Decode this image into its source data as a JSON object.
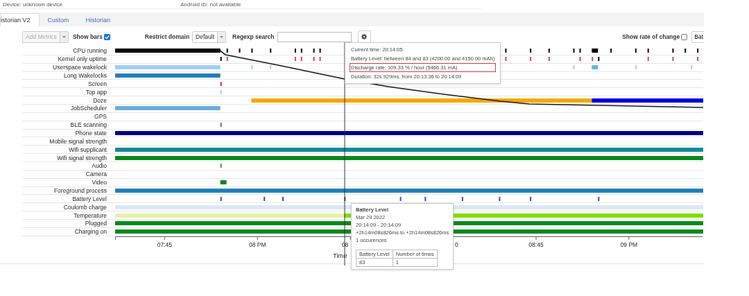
{
  "header": {
    "device": "Device: unknown device",
    "android_id": "Android ID: not available"
  },
  "tabs": [
    {
      "label": "istorian V2",
      "selected": true
    },
    {
      "label": "Custom",
      "selected": false
    },
    {
      "label": "Historian",
      "selected": false
    }
  ],
  "toolbar": {
    "add_metrics": {
      "label": "Add Metrics",
      "disabled": true
    },
    "show_bars": {
      "label": "Show bars",
      "checked": true
    },
    "restrict_domain": {
      "label": "Restrict domain",
      "value": "Default"
    },
    "regexp_search": {
      "label": "Regexp search"
    },
    "show_rate": {
      "label": "Show rate of change",
      "checked": false
    },
    "cut_button": "Bat"
  },
  "timeline": {
    "rows": [
      {
        "label": "CPU running",
        "color": "#000000"
      },
      {
        "label": "Kernel only uptime",
        "color": "#e8384f"
      },
      {
        "label": "Userspace wakelock",
        "color": "#9fd0f0"
      },
      {
        "label": "Long Wakelocks",
        "color": "#1f7fb8"
      },
      {
        "label": "Screen",
        "color": "#e82020"
      },
      {
        "label": "Top app",
        "color": "#9fd0f0"
      },
      {
        "label": "Doze",
        "color": "#f5a800"
      },
      {
        "label": "JobScheduler",
        "color": "#6aaedb"
      },
      {
        "label": "GPS"
      },
      {
        "label": "BLE scanning",
        "color": "#1a9a3a"
      },
      {
        "label": "Phone state",
        "color": "#000080"
      },
      {
        "label": "Mobile signal strength"
      },
      {
        "label": "Wifi supplicant",
        "color": "#128a9a"
      },
      {
        "label": "Wifi signal strength",
        "color": "#0a8a1a"
      },
      {
        "label": "Audio",
        "color": "#2aa02a"
      },
      {
        "label": "Camera"
      },
      {
        "label": "Video",
        "color": "#0a8a1a"
      },
      {
        "label": "Foreground process",
        "color": "#1f7fb8"
      },
      {
        "label": "Battery Level",
        "color": "#3a3ae0"
      },
      {
        "label": "Coulomb charge",
        "color": "#dce8f4"
      },
      {
        "label": "Temperature",
        "color": "#e8f0a8"
      },
      {
        "label": "Plugged",
        "color": "#0a8a1a"
      },
      {
        "label": "Charging on",
        "color": "#0a8a1a"
      }
    ],
    "x_ticks": [
      "07:45",
      "08 PM",
      "08",
      "0",
      "08:45",
      "09 PM"
    ],
    "x_label": "Time"
  },
  "info_tooltip": {
    "lines": [
      {
        "text": "Current time: 20:14:05",
        "highlighted": false
      },
      {
        "text": "Battery Level: between 84 and 83 (4200.00 and 4150.00 mAh)",
        "highlighted": false
      },
      {
        "text": "Discharge rate: 109.33 % / hour (5466.31 mA)",
        "highlighted": true
      },
      {
        "text": "Duration: 32s 929ms, from 20:13:36 to 20:14:09",
        "highlighted": false
      }
    ]
  },
  "battery_tooltip": {
    "title": "Battery Level",
    "lines": [
      "Mar 29 2022",
      "20:14:09 - 20:14:09",
      "+2h14m08s826ms to +2h14m08s826ms",
      "1 occurences"
    ],
    "table": {
      "columns": [
        "Battery Level",
        "Number of times"
      ],
      "rows": [
        [
          "83",
          "1"
        ]
      ]
    }
  }
}
